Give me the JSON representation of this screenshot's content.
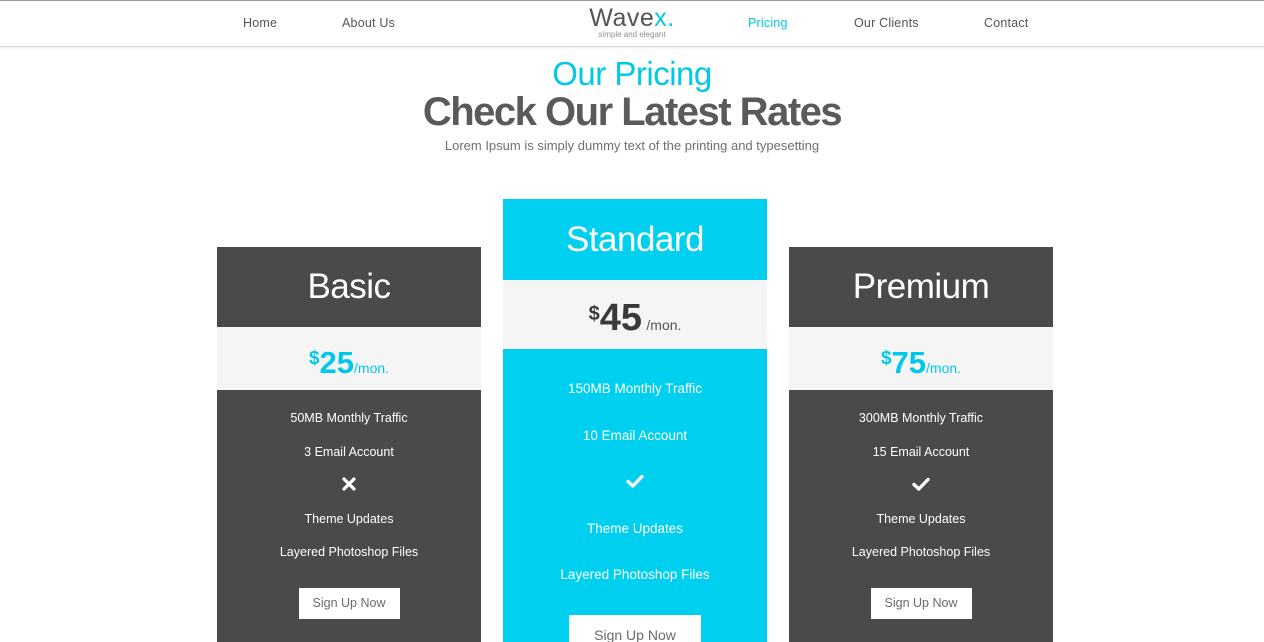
{
  "nav": {
    "home": "Home",
    "about": "About  Us",
    "pricing": "Pricing",
    "clients": "Our  Clients",
    "contact": "Contact",
    "active": "Pricing"
  },
  "logo": {
    "name": "Wave",
    "name_accent": "x.",
    "tagline": "simple and elegant"
  },
  "section": {
    "subtitle": "Our Pricing",
    "title": "Check Our Latest Rates",
    "description": "Lorem Ipsum is simply dummy text of the printing and typesetting"
  },
  "plans": [
    {
      "name": "Basic",
      "currency": "$",
      "price": "25",
      "period": "/mon.",
      "features": [
        "50MB Monthly Traffic",
        "3 Email Account"
      ],
      "included_icon": "cross-icon",
      "extras": [
        "Theme Updates",
        "Layered Photoshop Files"
      ],
      "button": "Sign Up Now"
    },
    {
      "name": "Standard",
      "currency": "$",
      "price": "45",
      "period": "/mon.",
      "features": [
        "150MB Monthly Traffic",
        "10 Email Account"
      ],
      "included_icon": "check-icon",
      "extras": [
        "Theme Updates",
        "Layered Photoshop Files"
      ],
      "button": "Sign Up Now"
    },
    {
      "name": "Premium",
      "currency": "$",
      "price": "75",
      "period": "/mon.",
      "features": [
        "300MB Monthly Traffic",
        "15 Email Account"
      ],
      "included_icon": "check-icon",
      "extras": [
        "Theme Updates",
        "Layered Photoshop Files"
      ],
      "button": "Sign Up Now"
    }
  ],
  "colors": {
    "accent": "#00c8e8",
    "dark_card": "#4a4a4a",
    "price_band": "#f5f5f5",
    "text_gray": "#5a5a5a"
  }
}
